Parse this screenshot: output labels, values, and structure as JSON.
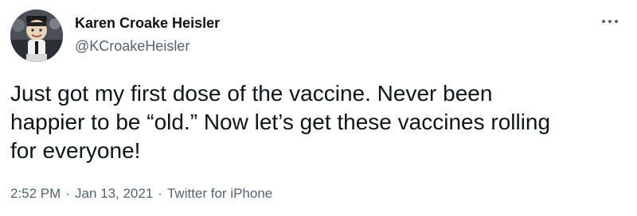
{
  "author": {
    "name": "Karen Croake Heisler",
    "handle": "@KCroakeHeisler",
    "avatar_icon": "avatar-image"
  },
  "more_icon": "more-dots-icon",
  "tweet": {
    "text_lines": [
      "Just got my first dose of the vaccine. Never been",
      "happier to be “old.” Now let’s get these vaccines rolling",
      "for everyone!"
    ]
  },
  "meta": {
    "time": "2:52 PM",
    "separator": "·",
    "date": "Jan 13, 2021",
    "source": "Twitter for iPhone"
  },
  "colors": {
    "primary_text": "#0f1419",
    "secondary_text": "#536471",
    "background": "#ffffff"
  }
}
